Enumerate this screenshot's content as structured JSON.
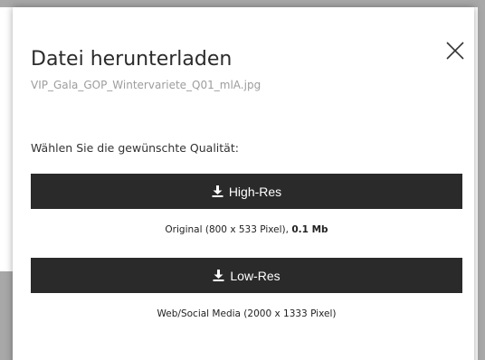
{
  "dialog": {
    "title": "Datei herunterladen",
    "filename": "VIP_Gala_GOP_Wintervariete_Q01_mlA.jpg",
    "prompt": "Wählen Sie die gewünschte Qualität:",
    "close_icon": "close-icon",
    "options": [
      {
        "label": "High-Res",
        "icon": "download-icon",
        "caption_prefix": "Original (800 x 533 Pixel),",
        "caption_size": "0.1 Mb"
      },
      {
        "label": "Low-Res",
        "icon": "download-icon",
        "caption": "Web/Social Media (2000 x 1333 Pixel)"
      }
    ]
  },
  "colors": {
    "button_bg": "#2a2a2a",
    "button_text": "#ffffff",
    "backdrop": "#a8a8a8"
  }
}
